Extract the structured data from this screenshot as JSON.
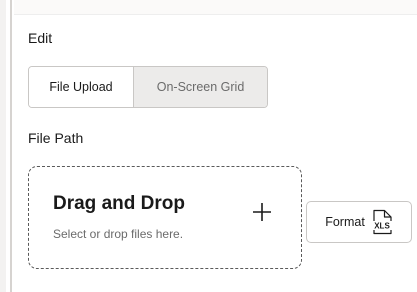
{
  "edit_section": {
    "label": "Edit",
    "tabs": [
      {
        "label": "File Upload",
        "selected": true
      },
      {
        "label": "On-Screen Grid",
        "selected": false
      }
    ]
  },
  "file_path_section": {
    "label": "File Path",
    "dropzone": {
      "title": "Drag and Drop",
      "subtitle": "Select or drop files here.",
      "add_icon": "plus-icon"
    },
    "format_button": {
      "label": "Format",
      "icon": "xls-file-icon",
      "icon_text": "XLS"
    }
  },
  "colors": {
    "border": "#c9c7c5",
    "inactive_tab_bg": "#ecebea",
    "muted_text": "#6b6b6b",
    "dropzone_border": "#5a5a5a"
  }
}
